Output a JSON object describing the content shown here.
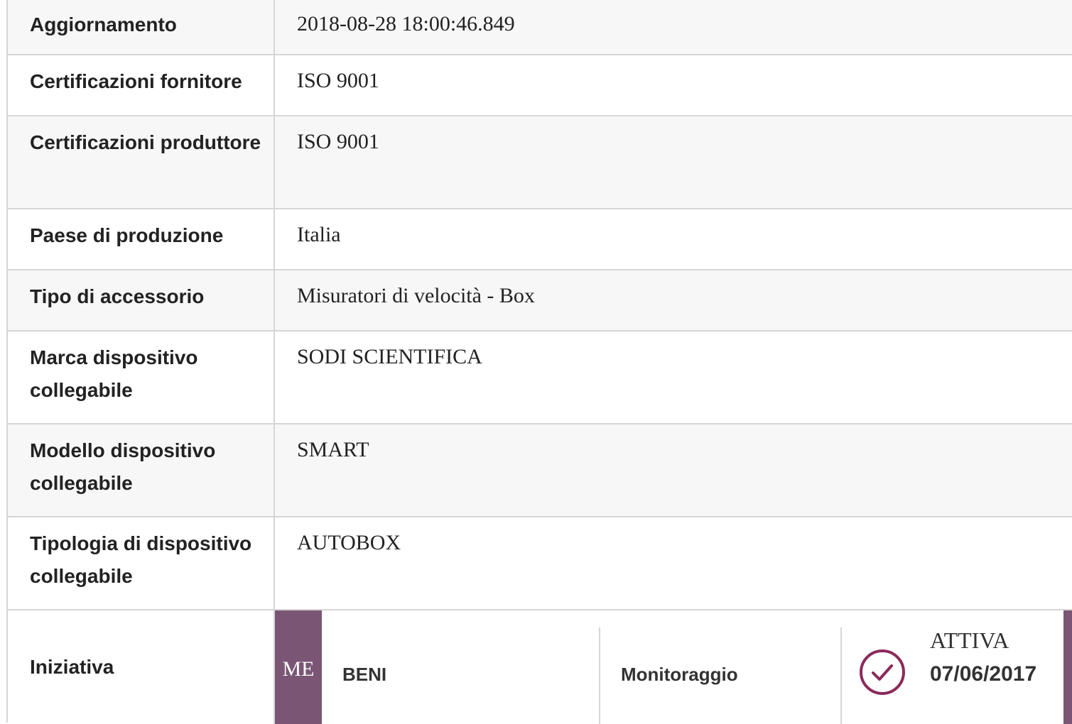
{
  "details": {
    "rows": [
      {
        "label": "Aggiornamento",
        "value": "2018-08-28 18:00:46.849"
      },
      {
        "label": "Certificazioni fornitore",
        "value": "ISO 9001"
      },
      {
        "label": "Certificazioni produttore",
        "value": "ISO 9001"
      },
      {
        "label": "Paese di produzione",
        "value": "Italia"
      },
      {
        "label": "Tipo di accessorio",
        "value": "Misuratori di velocità - Box"
      },
      {
        "label": "Marca dispositivo collegabile",
        "value": "SODI SCIENTIFICA"
      },
      {
        "label": "Modello dispositivo collegabile",
        "value": "SMART"
      },
      {
        "label": "Tipologia di dispositivo collegabile",
        "value": "AUTOBOX"
      }
    ]
  },
  "initiative": {
    "label": "Iniziativa",
    "badge": "ME",
    "category": "BENI",
    "monitoring": "Monitoraggio",
    "status": "ATTIVA",
    "date": "07/06/2017",
    "icon": "check-circle-icon",
    "accent_color": "#7a5674"
  }
}
